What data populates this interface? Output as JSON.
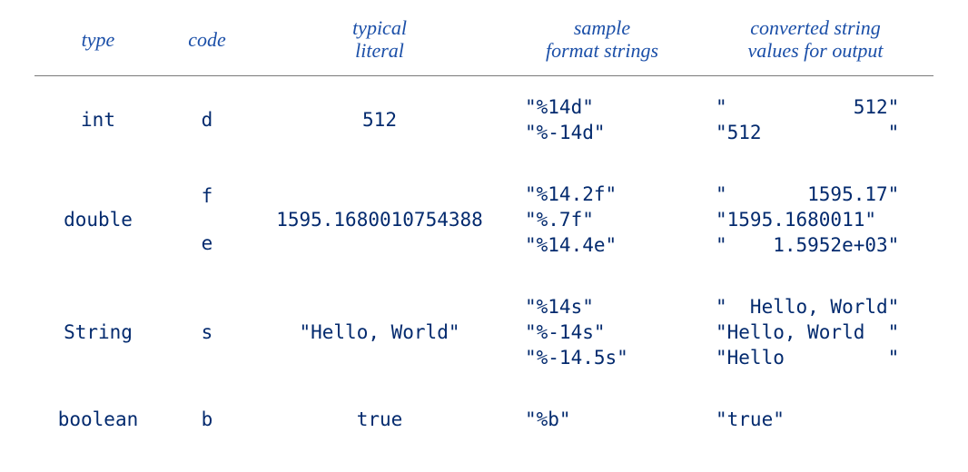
{
  "headers": {
    "type": "type",
    "code": "code",
    "literal_1": "typical",
    "literal_2": "literal",
    "format_1": "sample",
    "format_2": "format strings",
    "output_1": "converted string",
    "output_2": "values for output"
  },
  "rows": {
    "int": {
      "type": "int",
      "codes": [
        "d"
      ],
      "literal": "512",
      "formats": [
        "\"%14d\"",
        "\"%-14d\""
      ],
      "outputs": [
        "\"           512\"",
        "\"512           \""
      ]
    },
    "double": {
      "type": "double",
      "codes": [
        "f",
        "e"
      ],
      "literal": "1595.1680010754388",
      "formats": [
        "\"%14.2f\"",
        "\"%.7f\"",
        "\"%14.4e\""
      ],
      "outputs": [
        "\"       1595.17\"",
        "\"1595.1680011\"",
        "\"    1.5952e+03\""
      ]
    },
    "string": {
      "type": "String",
      "codes": [
        "s"
      ],
      "literal": "\"Hello, World\"",
      "formats": [
        "\"%14s\"",
        "\"%-14s\"",
        "\"%-14.5s\""
      ],
      "outputs": [
        "\"  Hello, World\"",
        "\"Hello, World  \"",
        "\"Hello         \""
      ]
    },
    "boolean": {
      "type": "boolean",
      "codes": [
        "b"
      ],
      "literal": "true",
      "formats": [
        "\"%b\""
      ],
      "outputs": [
        "\"true\""
      ]
    }
  }
}
